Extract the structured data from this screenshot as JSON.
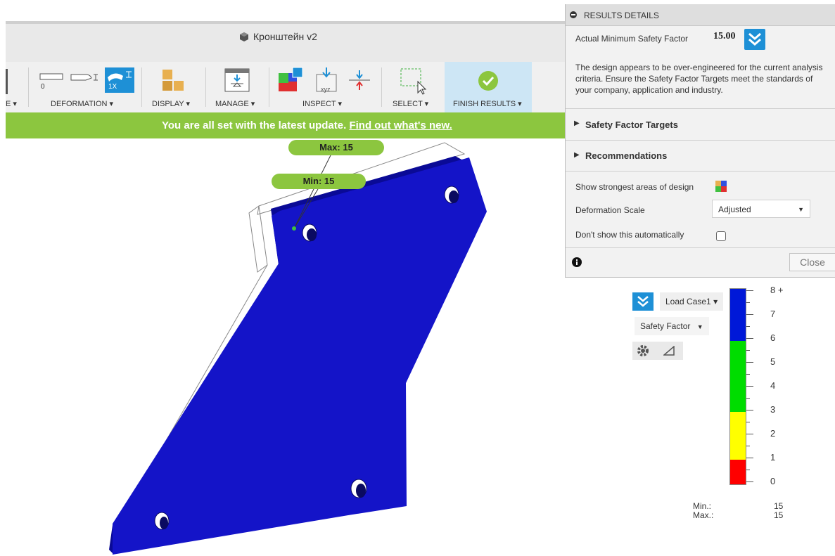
{
  "window": {
    "title": "Кронштейн v2"
  },
  "toolbar": {
    "partial_group_label": "E",
    "deformation": {
      "label": "DEFORMATION",
      "zero_label": "0",
      "onex_label": "1X"
    },
    "display": {
      "label": "DISPLAY"
    },
    "manage": {
      "label": "MANAGE"
    },
    "inspect": {
      "label": "INSPECT",
      "xyz_label": "xyz"
    },
    "select": {
      "label": "SELECT"
    },
    "finish": {
      "label": "FINISH RESULTS"
    },
    "caret": "▾"
  },
  "banner": {
    "text": "You are all set with the latest update. ",
    "link": "Find out what's new."
  },
  "callouts": {
    "max": "Max: 15",
    "min": "Min: 15"
  },
  "panel": {
    "header": "RESULTS DETAILS",
    "min_sf_label": "Actual Minimum Safety Factor",
    "min_sf_value": "15.00",
    "description": "The design appears to be over-engineered for the current analysis criteria. Ensure the Safety Factor Targets meet the standards of your company, application and industry.",
    "targets_label": "Safety Factor Targets",
    "recommendations_label": "Recommendations",
    "strongest_label": "Show strongest areas of design",
    "deformation_label": "Deformation Scale",
    "deformation_value": "Adjusted",
    "dont_show_label": "Don't show this automatically",
    "dont_show_checked": false,
    "info_icon": "info-icon",
    "close_label": "Close"
  },
  "legend": {
    "load_case": "Load Case1",
    "result_type": "Safety Factor",
    "scale_labels": [
      "8 +",
      "7",
      "6",
      "5",
      "4",
      "3",
      "2",
      "1",
      "0"
    ],
    "colors": {
      "red": "#ff0000",
      "yellow": "#ffff00",
      "green": "#00dd00",
      "blue": "#0018d8"
    },
    "min_label": "Min.:",
    "max_label": "Max.:",
    "min_value": "15",
    "max_value": "15"
  },
  "model": {
    "part_color": "#1414c8",
    "edge_color": "#0a0a96"
  }
}
